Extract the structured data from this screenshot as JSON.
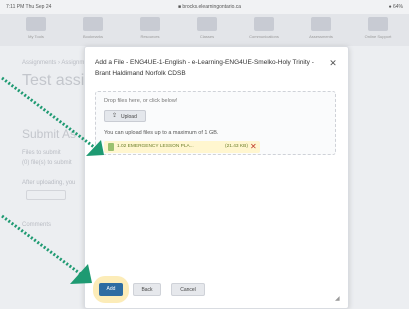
{
  "statusbar": {
    "time": "7:11 PM  Thu Sep 24",
    "url": "■ brocks.elearningontario.ca",
    "battery": "● 64%"
  },
  "nav": {
    "items": [
      "My Tools",
      "Bookmarks",
      "Resources",
      "Classes",
      "Communications",
      "Assessments",
      "Online Support"
    ]
  },
  "background": {
    "breadcrumb": "Assignments › Assignment",
    "title": "Test assig",
    "submit_heading": "Submit As",
    "file_label": "Files to submit",
    "file_value": "(0) file(s) to submit",
    "after_text": "After uploading, you",
    "comments_label": "Comments"
  },
  "modal": {
    "title": "Add a File - ENG4UE-1-English - e-Learning-ENG4UE-Smelko-Holy Trinity - Brant Haldimand Norfolk CDSB",
    "close_icon": "close-icon",
    "drop_text": "Drop files here, or click below!",
    "upload_label": "Upload",
    "upload_icon": "upload-icon",
    "limit_text": "You can upload files up to a maximum of 1 GB.",
    "file": {
      "name": "1.02 EMERGENCY LESSON PLA...",
      "size": "(21.43 KB)",
      "remove_icon": "remove-x-icon"
    },
    "buttons": {
      "add": "Add",
      "back": "Back",
      "cancel": "Cancel"
    }
  },
  "colors": {
    "primary": "#2d6ca2",
    "highlight": "#fbe7a6",
    "annotation_arrow": "#1e9a72",
    "remove": "#c0392b"
  }
}
